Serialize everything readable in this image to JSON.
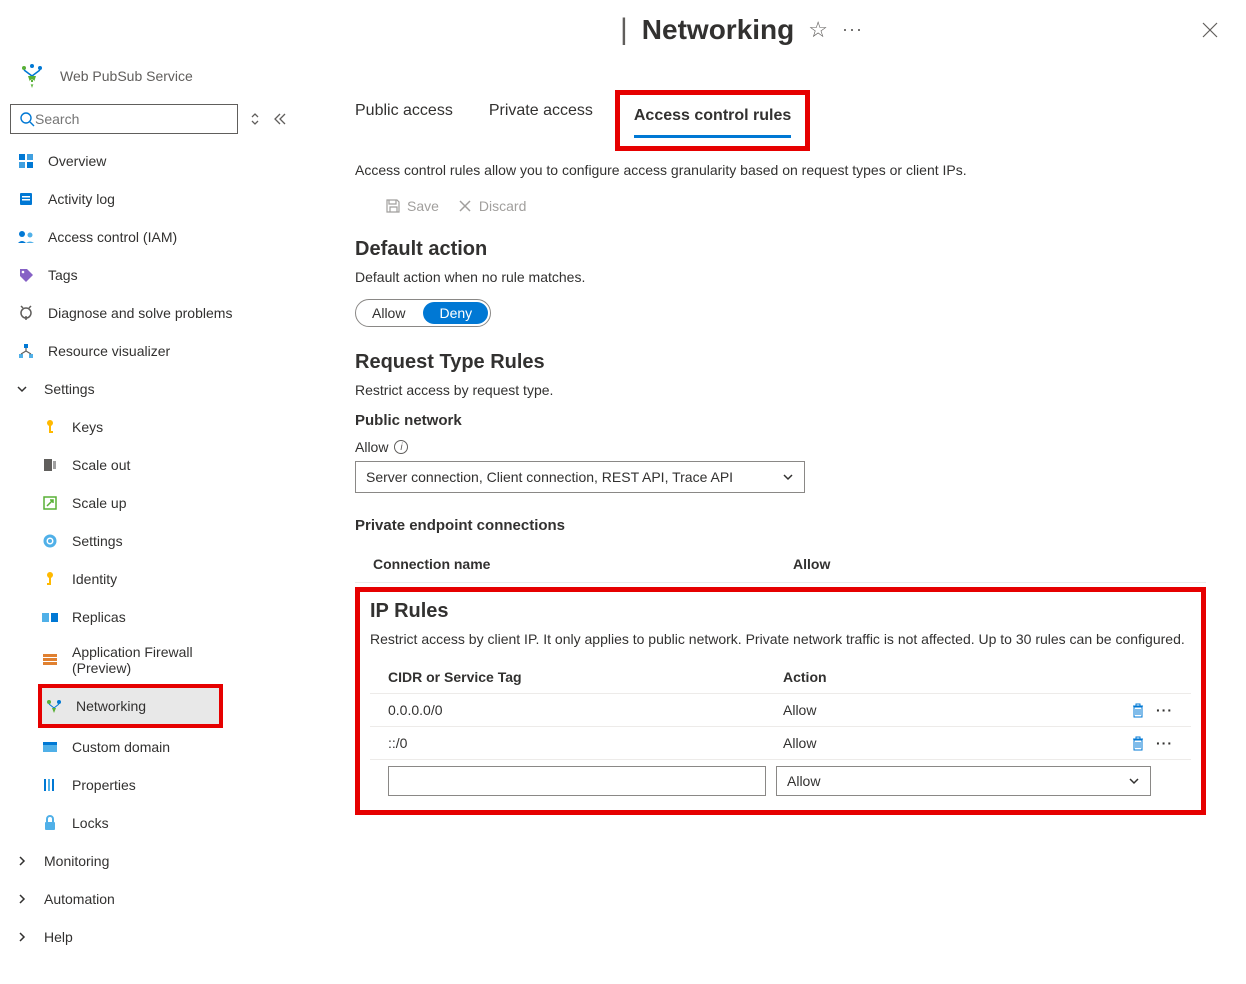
{
  "header": {
    "title": "Networking",
    "service_name": "Web PubSub Service",
    "search_placeholder": "Search"
  },
  "sidebar": {
    "items": [
      {
        "label": "Overview"
      },
      {
        "label": "Activity log"
      },
      {
        "label": "Access control (IAM)"
      },
      {
        "label": "Tags"
      },
      {
        "label": "Diagnose and solve problems"
      },
      {
        "label": "Resource visualizer"
      }
    ],
    "settings_label": "Settings",
    "settings_items": [
      {
        "label": "Keys"
      },
      {
        "label": "Scale out"
      },
      {
        "label": "Scale up"
      },
      {
        "label": "Settings"
      },
      {
        "label": "Identity"
      },
      {
        "label": "Replicas"
      },
      {
        "label": "Application Firewall (Preview)"
      },
      {
        "label": "Networking"
      },
      {
        "label": "Custom domain"
      },
      {
        "label": "Properties"
      },
      {
        "label": "Locks"
      }
    ],
    "bottom_items": [
      {
        "label": "Monitoring"
      },
      {
        "label": "Automation"
      },
      {
        "label": "Help"
      }
    ]
  },
  "tabs": {
    "public": "Public access",
    "private": "Private access",
    "acl": "Access control rules"
  },
  "desc": "Access control rules allow you to configure access granularity based on request types or client IPs.",
  "toolbar": {
    "save": "Save",
    "discard": "Discard"
  },
  "default_action": {
    "heading": "Default action",
    "desc": "Default action when no rule matches.",
    "allow": "Allow",
    "deny": "Deny"
  },
  "request_type": {
    "heading": "Request Type Rules",
    "desc": "Restrict access by request type.",
    "public_net": "Public network",
    "allow_label": "Allow",
    "select_value": "Server connection, Client connection, REST API, Trace API",
    "private_heading": "Private endpoint connections",
    "col_conn": "Connection name",
    "col_allow": "Allow"
  },
  "ip_rules": {
    "heading": "IP Rules",
    "desc": "Restrict access by client IP. It only applies to public network. Private network traffic is not affected. Up to 30 rules can be configured.",
    "col_cidr": "CIDR or Service Tag",
    "col_action": "Action",
    "rows": [
      {
        "cidr": "0.0.0.0/0",
        "action": "Allow"
      },
      {
        "cidr": "::/0",
        "action": "Allow"
      }
    ],
    "new_action": "Allow"
  }
}
